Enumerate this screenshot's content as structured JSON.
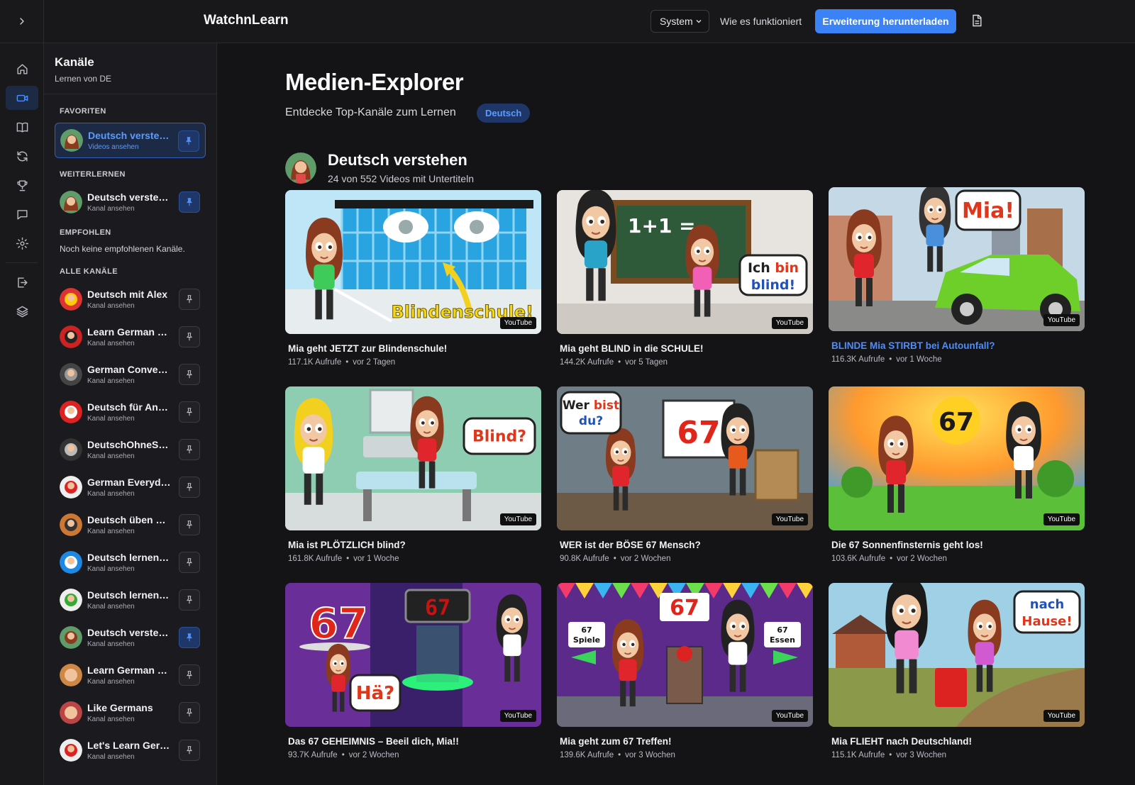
{
  "brand": "WatchnLearn",
  "header": {
    "system_select": "System",
    "how_link": "Wie es funktioniert",
    "download_button": "Erweiterung herunterladen"
  },
  "sidebar": {
    "title": "Kanäle",
    "subtitle": "Lernen von DE",
    "sections": {
      "favorites": "FAVORITEN",
      "continue": "WEITERLERNEN",
      "recommended": "EMPFOHLEN",
      "all": "ALLE KANÄLE"
    },
    "recommended_empty": "Noch keine empfohlenen Kanäle.",
    "favorites": [
      {
        "name": "Deutsch verstehen",
        "status": "Videos ansehen",
        "pinned": true
      }
    ],
    "continue": [
      {
        "name": "Deutsch verstehen",
        "status": "Kanal ansehen",
        "pinned": true
      }
    ],
    "all": [
      {
        "name": "Deutsch mit Alex",
        "status": "Kanal ansehen",
        "pinned": false
      },
      {
        "name": "Learn German Po...",
        "status": "Kanal ansehen",
        "pinned": false
      },
      {
        "name": "German Conversa...",
        "status": "Kanal ansehen",
        "pinned": false
      },
      {
        "name": "Deutsch für Anfä...",
        "status": "Kanal ansehen",
        "pinned": false
      },
      {
        "name": "DeutschOhneStr...",
        "status": "Kanal ansehen",
        "pinned": false
      },
      {
        "name": "German Everyday",
        "status": "Kanal ansehen",
        "pinned": false
      },
      {
        "name": "Deutsch üben mit...",
        "status": "Kanal ansehen",
        "pinned": false
      },
      {
        "name": "Deutsch lernen m...",
        "status": "Kanal ansehen",
        "pinned": false
      },
      {
        "name": "Deutsch lernen - ...",
        "status": "Kanal ansehen",
        "pinned": false
      },
      {
        "name": "Deutsch verstehen",
        "status": "Kanal ansehen",
        "pinned": true
      },
      {
        "name": "Learn German Fast",
        "status": "Kanal ansehen",
        "pinned": false
      },
      {
        "name": "Like Germans",
        "status": "Kanal ansehen",
        "pinned": false
      },
      {
        "name": "Let's Learn Germ...",
        "status": "Kanal ansehen",
        "pinned": false
      }
    ]
  },
  "main": {
    "title": "Medien-Explorer",
    "subtitle": "Entdecke Top-Kanäle zum Lernen",
    "language_badge": "Deutsch",
    "channel": {
      "name": "Deutsch verstehen",
      "summary": "24 von 552 Videos mit Untertiteln"
    },
    "source_badge": "YouTube",
    "videos": [
      {
        "title": "Mia geht JETZT zur Blindenschule!",
        "views": "117.1K Aufrufe",
        "age": "vor 2 Tagen",
        "overlay": "Blindenschule!"
      },
      {
        "title": "Mia geht BLIND in die SCHULE!",
        "views": "144.2K Aufrufe",
        "age": "vor 5 Tagen",
        "overlay": "Ich bin blind!"
      },
      {
        "title": "BLINDE Mia STIRBT bei Autounfall?",
        "views": "116.3K Aufrufe",
        "age": "vor 1 Woche",
        "overlay": "Mia!"
      },
      {
        "title": "Mia ist PLÖTZLICH blind?",
        "views": "161.8K Aufrufe",
        "age": "vor 1 Woche",
        "overlay": "Blind?"
      },
      {
        "title": "WER ist der BÖSE 67 Mensch?",
        "views": "90.8K Aufrufe",
        "age": "vor 2 Wochen",
        "overlay": "Wer bist du?"
      },
      {
        "title": "Die 67 Sonnenfinsternis geht los!",
        "views": "103.6K Aufrufe",
        "age": "vor 2 Wochen",
        "overlay": "67"
      },
      {
        "title": "Das 67 GEHEIMNIS – Beeil dich, Mia!!",
        "views": "93.7K Aufrufe",
        "age": "vor 2 Wochen",
        "overlay": "Hä?"
      },
      {
        "title": "Mia geht zum 67 Treffen!",
        "views": "139.6K Aufrufe",
        "age": "vor 3 Wochen",
        "overlay": "67"
      },
      {
        "title": "Mia FLIEHT nach Deutschland!",
        "views": "115.1K Aufrufe",
        "age": "vor 3 Wochen",
        "overlay": "nach Hause!"
      }
    ]
  },
  "colors": {
    "accent": "#3b82f6",
    "background": "#141417",
    "panel": "#1b1b1f"
  }
}
